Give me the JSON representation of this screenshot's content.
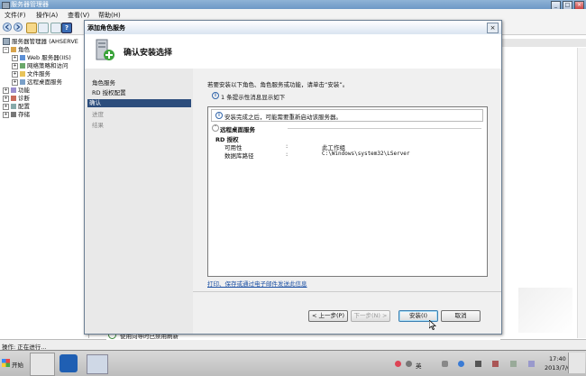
{
  "window": {
    "title": "服务器管理器",
    "controls": {
      "minimize": "_",
      "maximize": "□",
      "close": "×"
    }
  },
  "menubar": {
    "items": [
      "文件(F)",
      "操作(A)",
      "查看(V)",
      "帮助(H)"
    ]
  },
  "tree": {
    "root": "服务器管理器 (AHSERVE",
    "items": [
      {
        "label": "角色",
        "expander": "−"
      },
      {
        "label": "Web 服务器(IIS)",
        "expander": "+"
      },
      {
        "label": "网络策略和访问",
        "expander": "+"
      },
      {
        "label": "文件服务",
        "expander": "+"
      },
      {
        "label": "远程桌面服务",
        "expander": "+"
      },
      {
        "label": "功能",
        "expander": "+"
      },
      {
        "label": "诊断",
        "expander": "+"
      },
      {
        "label": "配置",
        "expander": "+"
      },
      {
        "label": "存储",
        "expander": "+"
      }
    ]
  },
  "dialog": {
    "title": "添加角色服务",
    "close": "×",
    "header": "确认安装选择",
    "nav": [
      {
        "label": "角色服务",
        "state": "normal"
      },
      {
        "label": "RD 授权配置",
        "state": "normal"
      },
      {
        "label": "确认",
        "state": "selected"
      },
      {
        "label": "进度",
        "state": "disabled"
      },
      {
        "label": "结果",
        "state": "disabled"
      }
    ],
    "intro": "若要安装以下角色、角色服务或功能，请单击“安装”。",
    "info_count": "1 条提示性消息显示如下",
    "notice": "安装完成之后，可能需要重新启动该服务器。",
    "section_title": "远程桌面服务",
    "subsection": "RD 授权",
    "details": [
      {
        "key": "可用性",
        "value": "此工作组"
      },
      {
        "key": "数据库路径",
        "value": "C:\\Windows\\system32\\LServer"
      }
    ],
    "print_link": "打印、保存或通过电子邮件发送此信息",
    "buttons": {
      "prev": "< 上一步(P)",
      "next": "下一步(N) >",
      "install": "安装(I)",
      "cancel": "取消"
    }
  },
  "status": {
    "refresh_disabled": "使用向导时已禁用刷新",
    "operation": "操作:  正在进行..."
  },
  "taskbar": {
    "start": "开始",
    "ime": "英",
    "time": "17:40",
    "date": "2013/7/6"
  },
  "colors": {
    "nav_selected": "#2c4d7c",
    "link": "#1a4fa3",
    "title_bar": "#6d98c6"
  }
}
